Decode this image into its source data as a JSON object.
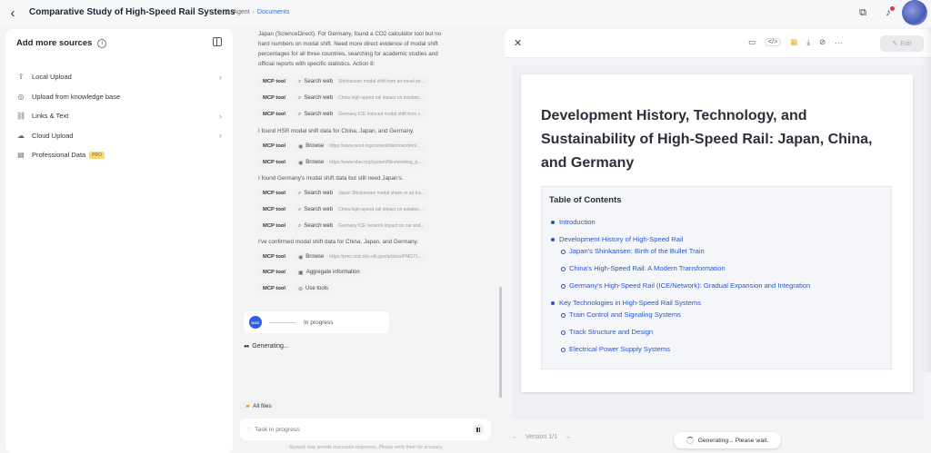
{
  "header": {
    "title": "Comparative Study of High-Speed Rail Systems",
    "breadcrumb": [
      "Agent",
      "Documents"
    ],
    "icons": [
      "share-icon",
      "bell-icon",
      "avatar"
    ]
  },
  "sidebar": {
    "title": "Add more sources",
    "items": [
      {
        "label": "Local Upload",
        "icon": "upload-icon",
        "has_chevron": true
      },
      {
        "label": "Upload from knowledge base",
        "icon": "database-icon",
        "has_chevron": false
      },
      {
        "label": "Links & Text",
        "icon": "link-icon",
        "has_chevron": true
      },
      {
        "label": "Cloud Upload",
        "icon": "cloud-icon",
        "has_chevron": true
      },
      {
        "label": "Professional Data",
        "icon": "file-icon",
        "has_chevron": false,
        "badge": "PRO"
      }
    ]
  },
  "chat": {
    "intro_lines": [
      "Japan (ScienceDirect). For Germany, found a CO2 calculator tool but no",
      "hard numbers on modal shift. Need more direct evidence of modal shift",
      "percentages for all three countries, searching for academic studies and",
      "official reports with specific statistics. Action 8:"
    ],
    "group1": [
      {
        "tag": "MCP tool",
        "action": "Search web",
        "detail": "Shinkansen modal shift from air travel pe..."
      },
      {
        "tag": "MCP tool",
        "action": "Search web",
        "detail": "China high-speed rail impact on aviation..."
      },
      {
        "tag": "MCP tool",
        "action": "Search web",
        "detail": "Germany ICE induced modal shift from r..."
      }
    ],
    "note1": "I found HSR modal shift data for China, Japan, and Germany.",
    "group2": [
      {
        "tag": "MCP tool",
        "action": "Browse",
        "detail": "https://www.oecd.org/content/dam/oecd/en/..."
      },
      {
        "tag": "MCP tool",
        "action": "Browse",
        "detail": "https://www.nber.org/system/files/working_p..."
      }
    ],
    "note2": "I found Germany's modal shift data but still need Japan's.",
    "group3": [
      {
        "tag": "MCP tool",
        "action": "Search web",
        "detail": "Japan Shinkansen modal share vs air tra..."
      },
      {
        "tag": "MCP tool",
        "action": "Search web",
        "detail": "China high-speed rail impact on aviation..."
      },
      {
        "tag": "MCP tool",
        "action": "Search web",
        "detail": "Germany ICE network impact on car and..."
      }
    ],
    "note3": "I've confirmed modal shift data for China, Japan, and Germany.",
    "group4": [
      {
        "tag": "MCP tool",
        "action": "Browse",
        "detail": "https://pmc.ncbi.nlm.nih.gov/articles/PMC71..."
      },
      {
        "tag": "MCP tool",
        "action": "Aggregate information",
        "detail": ""
      },
      {
        "tag": "MCP tool",
        "action": "Use tools",
        "detail": ""
      }
    ],
    "progress": {
      "badge": "DOC",
      "status": "In progress"
    },
    "generating": "Generating...",
    "all_files": "All files",
    "input_placeholder": "Task in progress",
    "disclaimer": "Skywork may provide inaccurate responses. Please verify them for accuracy."
  },
  "document": {
    "edit_label": "Edit",
    "heading": "Development History, Technology, and Sustainability of High-Speed Rail: Japan, China, and Germany",
    "toc_title": "Table of Contents",
    "toc": [
      {
        "label": "Introduction",
        "level": 1
      },
      {
        "label": "Development History of High-Speed Rail",
        "level": 1
      },
      {
        "label": "Japan's Shinkansen: Birth of the Bullet Train",
        "level": 2
      },
      {
        "label": "China's High-Speed Rail: A Modern Transformation",
        "level": 2
      },
      {
        "label": "Germany's High-Speed Rail (ICE/Network): Gradual Expansion and Integration",
        "level": 2
      },
      {
        "label": "Key Technologies in High-Speed Rail Systems",
        "level": 1
      },
      {
        "label": "Train Control and Signaling Systems",
        "level": 2
      },
      {
        "label": "Track Structure and Design",
        "level": 2
      },
      {
        "label": "Electrical Power Supply Systems",
        "level": 2
      }
    ],
    "generating_pill": "Generating... Please wait.",
    "version": "Version 1/1"
  }
}
